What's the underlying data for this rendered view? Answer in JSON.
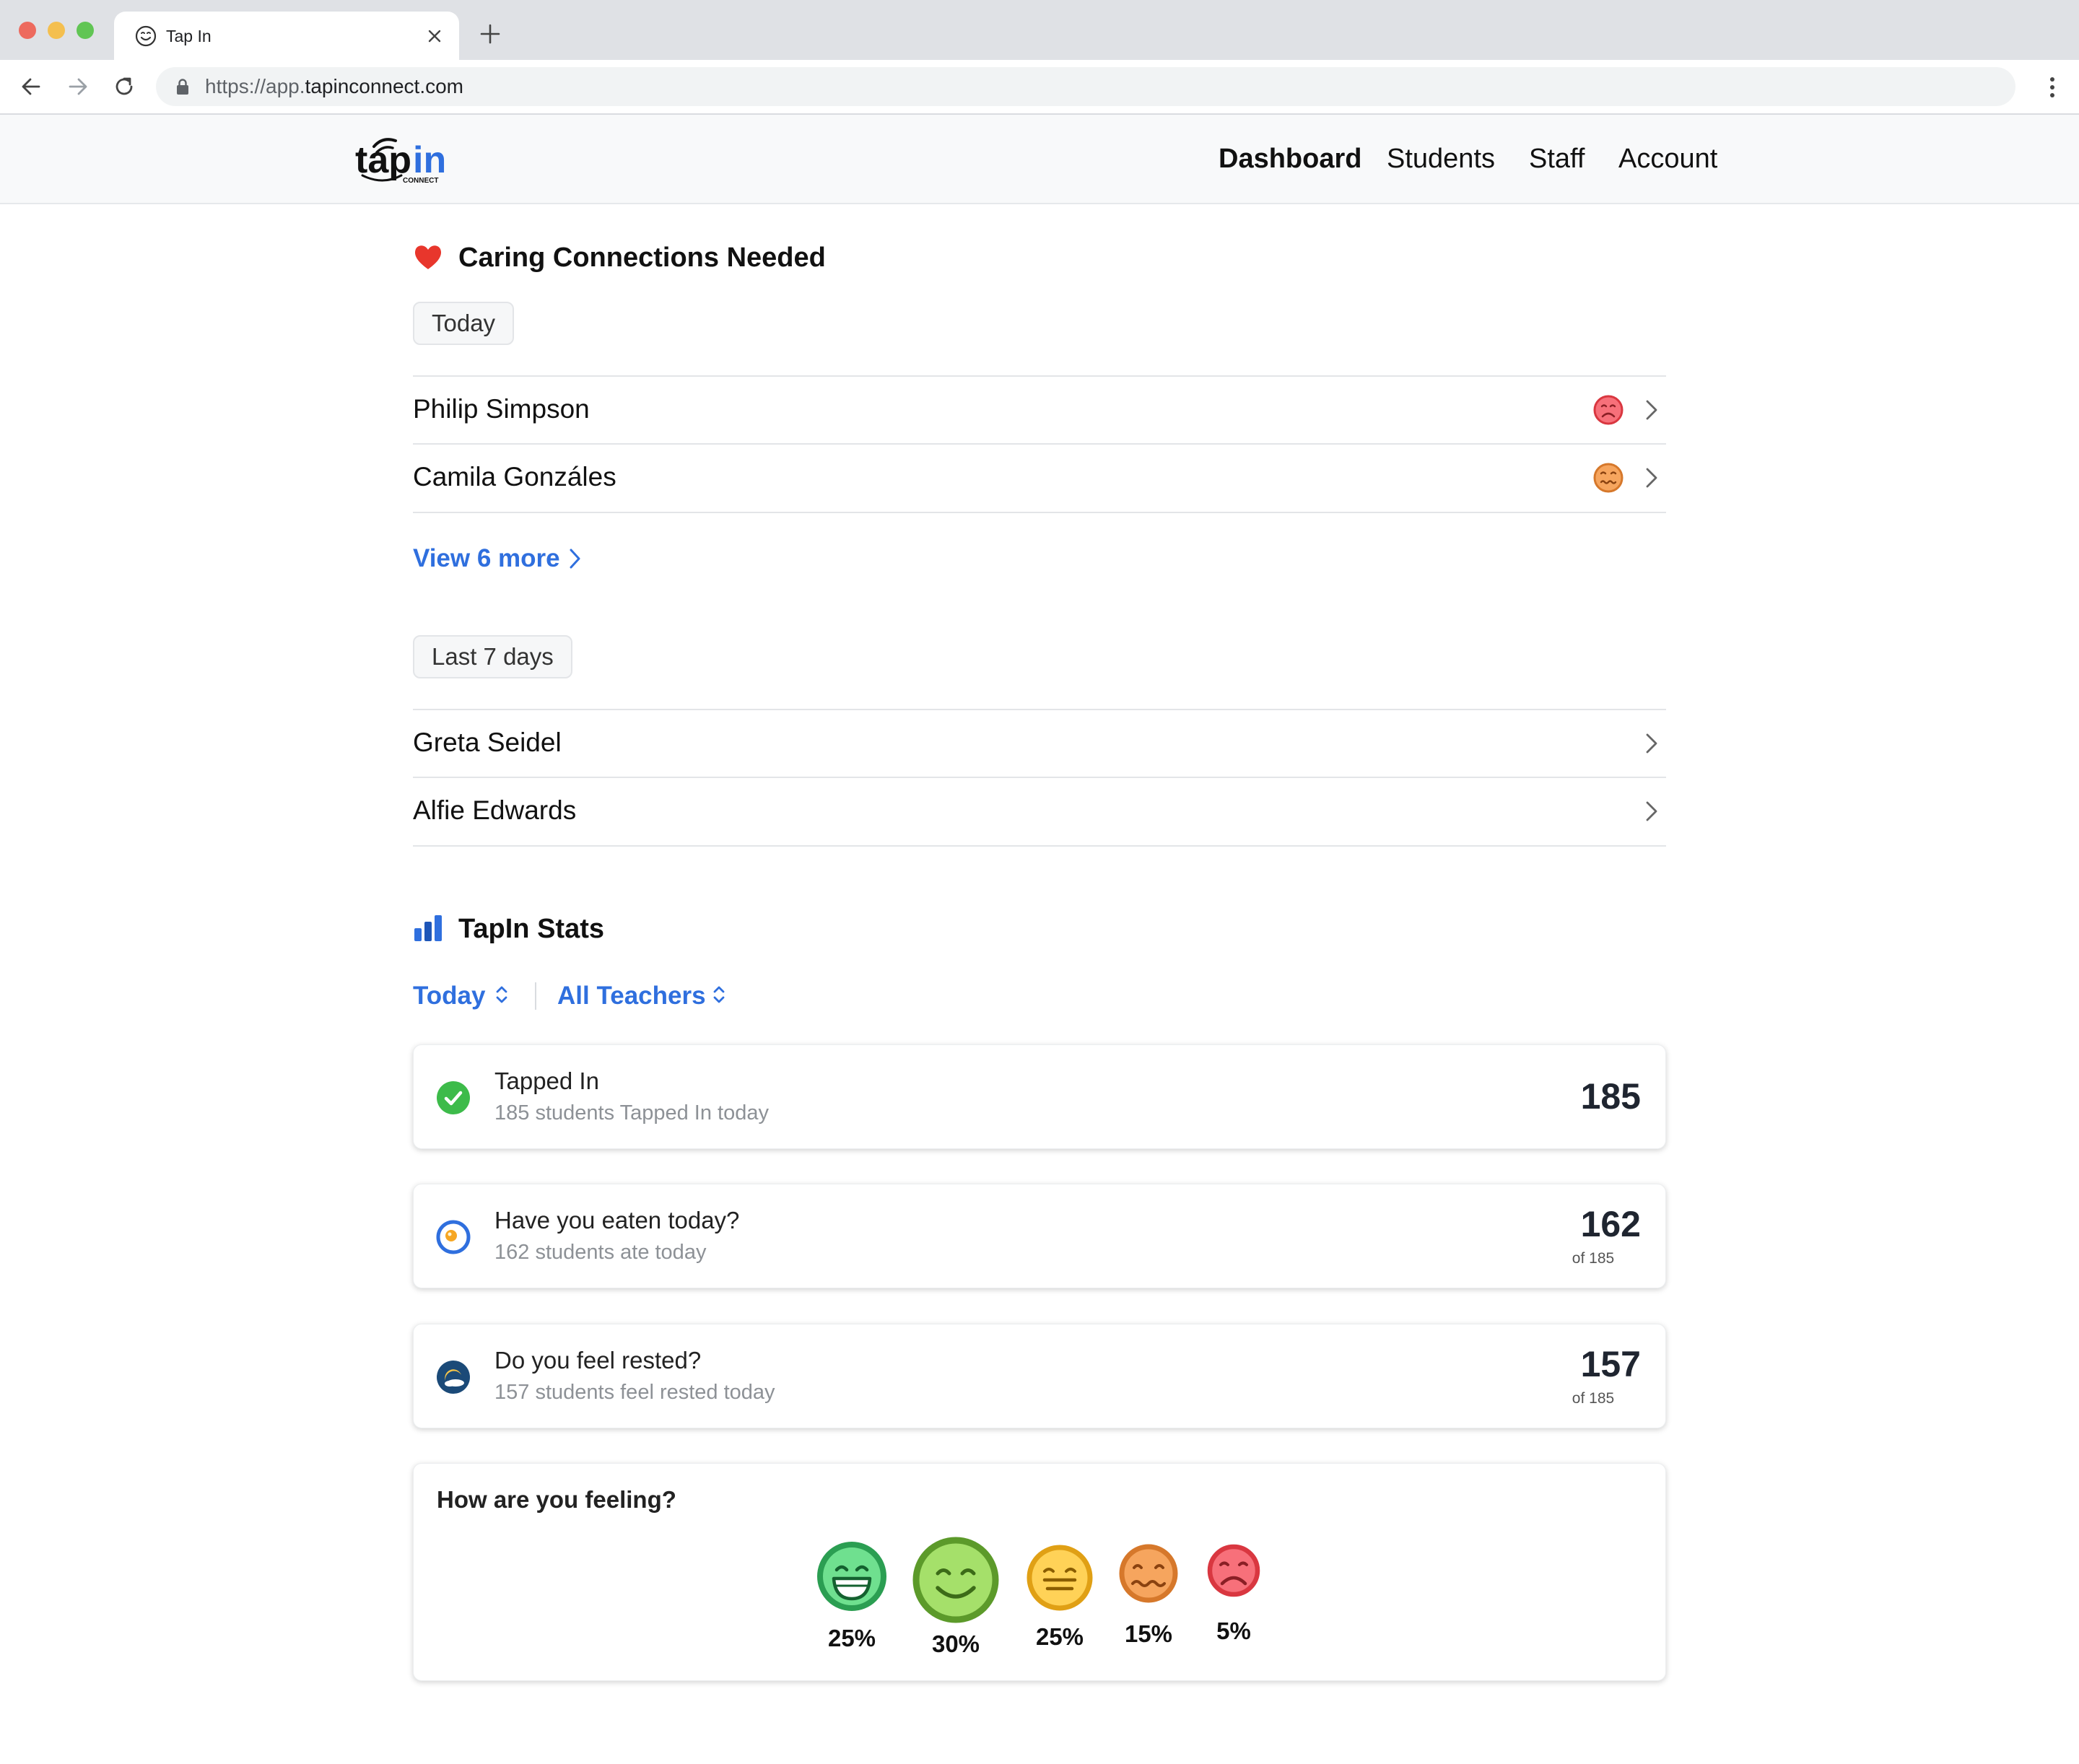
{
  "browser": {
    "tab_title": "Tap In",
    "url_prefix": "https://app.",
    "url_host": "tapinconnect.com"
  },
  "header": {
    "logo_text": "tapin",
    "logo_subtext": "CONNECT",
    "nav": [
      "Dashboard",
      "Students",
      "Staff",
      "Account"
    ],
    "active_nav": "Dashboard"
  },
  "caring": {
    "title": "Caring Connections Needed",
    "today_label": "Today",
    "today_students": [
      {
        "name": "Philip Simpson",
        "mood": "sad"
      },
      {
        "name": "Camila Gonzáles",
        "mood": "worried"
      }
    ],
    "view_more": "View 6 more",
    "week_label": "Last 7 days",
    "week_students": [
      {
        "name": "Greta Seidel"
      },
      {
        "name": "Alfie Edwards"
      }
    ]
  },
  "stats": {
    "title": "TapIn Stats",
    "filter_period": "Today",
    "filter_teacher": "All Teachers",
    "cards": [
      {
        "title": "Tapped In",
        "subtitle": "185 students Tapped In today",
        "value": "185",
        "icon": "check-icon"
      },
      {
        "title": "Have you eaten today?",
        "subtitle": "162 students ate today",
        "value": "162",
        "of": "of 185",
        "icon": "egg-icon"
      },
      {
        "title": "Do you feel rested?",
        "subtitle": "157 students feel rested today",
        "value": "157",
        "of": "of 185",
        "icon": "moon-icon"
      }
    ],
    "feeling": {
      "title": "How are you feeling?",
      "moods": [
        {
          "name": "very-happy",
          "percent": "25%",
          "value": 25,
          "color": "#3fbf6a"
        },
        {
          "name": "happy",
          "percent": "30%",
          "value": 30,
          "color": "#7cc243"
        },
        {
          "name": "neutral",
          "percent": "25%",
          "value": 25,
          "color": "#f0b323"
        },
        {
          "name": "worried",
          "percent": "15%",
          "value": 15,
          "color": "#e98a3a"
        },
        {
          "name": "sad",
          "percent": "5%",
          "value": 5,
          "color": "#e5464f"
        }
      ]
    }
  },
  "colors": {
    "accent": "#2f6fde",
    "heart": "#e8362c",
    "text": "#111111"
  }
}
